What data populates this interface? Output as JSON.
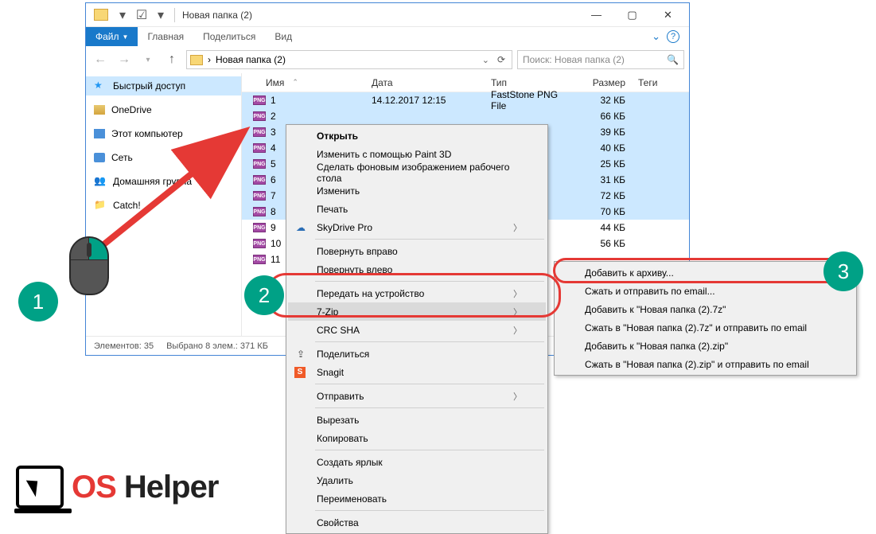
{
  "window": {
    "title": "Новая папка (2)",
    "tabs": {
      "file": "Файл",
      "home": "Главная",
      "share": "Поделиться",
      "view": "Вид"
    }
  },
  "nav": {
    "path_sep": "›",
    "path": "Новая папка (2)",
    "search_placeholder": "Поиск: Новая папка (2)"
  },
  "sidebar": {
    "items": [
      {
        "label": "Быстрый доступ"
      },
      {
        "label": "OneDrive"
      },
      {
        "label": "Этот компьютер"
      },
      {
        "label": "Сеть"
      },
      {
        "label": "Домашняя группа"
      },
      {
        "label": "Catch!"
      }
    ]
  },
  "columns": {
    "name": "Имя",
    "date": "Дата",
    "type": "Тип",
    "size": "Размер",
    "tags": "Теги"
  },
  "files": [
    {
      "name": "1",
      "date": "14.12.2017 12:15",
      "type": "FastStone PNG File",
      "size": "32 КБ",
      "sel": true
    },
    {
      "name": "2",
      "date": "",
      "type": "",
      "size": "66 КБ",
      "sel": true
    },
    {
      "name": "3",
      "date": "",
      "type": "",
      "size": "39 КБ",
      "sel": true
    },
    {
      "name": "4",
      "date": "",
      "type": "",
      "size": "40 КБ",
      "sel": true
    },
    {
      "name": "5",
      "date": "",
      "type": "",
      "size": "25 КБ",
      "sel": true
    },
    {
      "name": "6",
      "date": "",
      "type": "",
      "size": "31 КБ",
      "sel": true
    },
    {
      "name": "7",
      "date": "",
      "type": "",
      "size": "72 КБ",
      "sel": true
    },
    {
      "name": "8",
      "date": "",
      "type": "",
      "size": "70 КБ",
      "sel": true
    },
    {
      "name": "9",
      "date": "",
      "type": "",
      "size": "44 КБ",
      "sel": false
    },
    {
      "name": "10",
      "date": "",
      "type": "",
      "size": "56 КБ",
      "sel": false
    },
    {
      "name": "11",
      "date": "",
      "type": "",
      "size": "",
      "sel": false
    }
  ],
  "status": {
    "items": "Элементов: 35",
    "selected": "Выбрано 8 элем.: 371 КБ"
  },
  "ctx1": [
    {
      "t": "Открыть",
      "bold": true
    },
    {
      "t": "Изменить с помощью Paint 3D"
    },
    {
      "t": "Сделать фоновым изображением рабочего стола"
    },
    {
      "t": "Изменить"
    },
    {
      "t": "Печать"
    },
    {
      "t": "SkyDrive Pro",
      "sub": true,
      "ico": "cloud"
    },
    {
      "sep": true
    },
    {
      "t": "Повернуть вправо"
    },
    {
      "t": "Повернуть влево"
    },
    {
      "sep": true
    },
    {
      "t": "Передать на устройство",
      "sub": true
    },
    {
      "t": "7-Zip",
      "sub": true,
      "hi": true
    },
    {
      "t": "CRC SHA",
      "sub": true
    },
    {
      "sep": true
    },
    {
      "t": "Поделиться",
      "ico": "share"
    },
    {
      "t": "Snagit",
      "ico": "snagit"
    },
    {
      "sep": true
    },
    {
      "t": "Отправить",
      "sub": true
    },
    {
      "sep": true
    },
    {
      "t": "Вырезать"
    },
    {
      "t": "Копировать"
    },
    {
      "sep": true
    },
    {
      "t": "Создать ярлык"
    },
    {
      "t": "Удалить"
    },
    {
      "t": "Переименовать"
    },
    {
      "sep": true
    },
    {
      "t": "Свойства"
    }
  ],
  "ctx2": [
    {
      "t": "Добавить к архиву..."
    },
    {
      "t": "Сжать и отправить по email..."
    },
    {
      "t": "Добавить к \"Новая папка (2).7z\""
    },
    {
      "t": "Сжать в \"Новая папка (2).7z\" и отправить по email"
    },
    {
      "t": "Добавить к \"Новая папка (2).zip\""
    },
    {
      "t": "Сжать в \"Новая папка (2).zip\" и отправить по email"
    }
  ],
  "badges": {
    "b1": "1",
    "b2": "2",
    "b3": "3"
  },
  "logo": {
    "os": "OS",
    "helper": " Helper"
  }
}
